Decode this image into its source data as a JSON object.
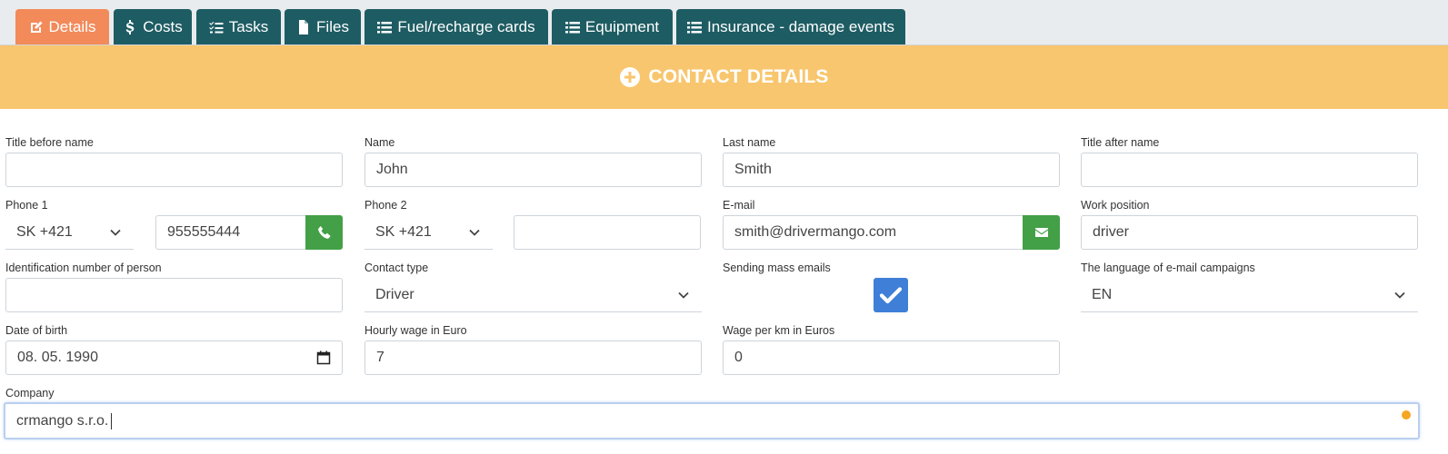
{
  "tabs": [
    {
      "label": "Details",
      "icon": "edit-icon",
      "active": true
    },
    {
      "label": "Costs",
      "icon": "dollar-icon"
    },
    {
      "label": "Tasks",
      "icon": "tasks-icon"
    },
    {
      "label": "Files",
      "icon": "file-icon"
    },
    {
      "label": "Fuel/recharge cards",
      "icon": "list-icon"
    },
    {
      "label": "Equipment",
      "icon": "list-icon"
    },
    {
      "label": "Insurance - damage events",
      "icon": "list-icon"
    }
  ],
  "section": {
    "title": "CONTACT DETAILS",
    "icon": "plus-circle-icon"
  },
  "colors": {
    "header_bg": "#f8c66e",
    "tab_bg": "#1e5c63",
    "tab_active_bg": "#f28a5a",
    "addon_green": "#43a047",
    "checkbox_blue": "#3f7fd8"
  },
  "form": {
    "title_before": {
      "label": "Title before name",
      "value": ""
    },
    "name": {
      "label": "Name",
      "value": "John"
    },
    "last_name": {
      "label": "Last name",
      "value": "Smith"
    },
    "title_after": {
      "label": "Title after name",
      "value": ""
    },
    "phone1": {
      "label": "Phone 1",
      "prefix": "SK +421",
      "value": "955555444"
    },
    "phone2": {
      "label": "Phone 2",
      "prefix": "SK +421",
      "value": ""
    },
    "email": {
      "label": "E-mail",
      "value": "smith@drivermango.com"
    },
    "work_position": {
      "label": "Work position",
      "value": "driver"
    },
    "id_number": {
      "label": "Identification number of person",
      "value": ""
    },
    "contact_type": {
      "label": "Contact type",
      "value": "Driver"
    },
    "mass_emails": {
      "label": "Sending mass emails",
      "checked": true
    },
    "campaign_language": {
      "label": "The language of e-mail campaigns",
      "value": "EN"
    },
    "date_of_birth": {
      "label": "Date of birth",
      "value": "08. 05. 1990"
    },
    "hourly_wage": {
      "label": "Hourly wage in Euro",
      "value": "7"
    },
    "wage_per_km": {
      "label": "Wage per km in Euros",
      "value": "0"
    },
    "company": {
      "label": "Company",
      "value": "crmango s.r.o."
    }
  }
}
